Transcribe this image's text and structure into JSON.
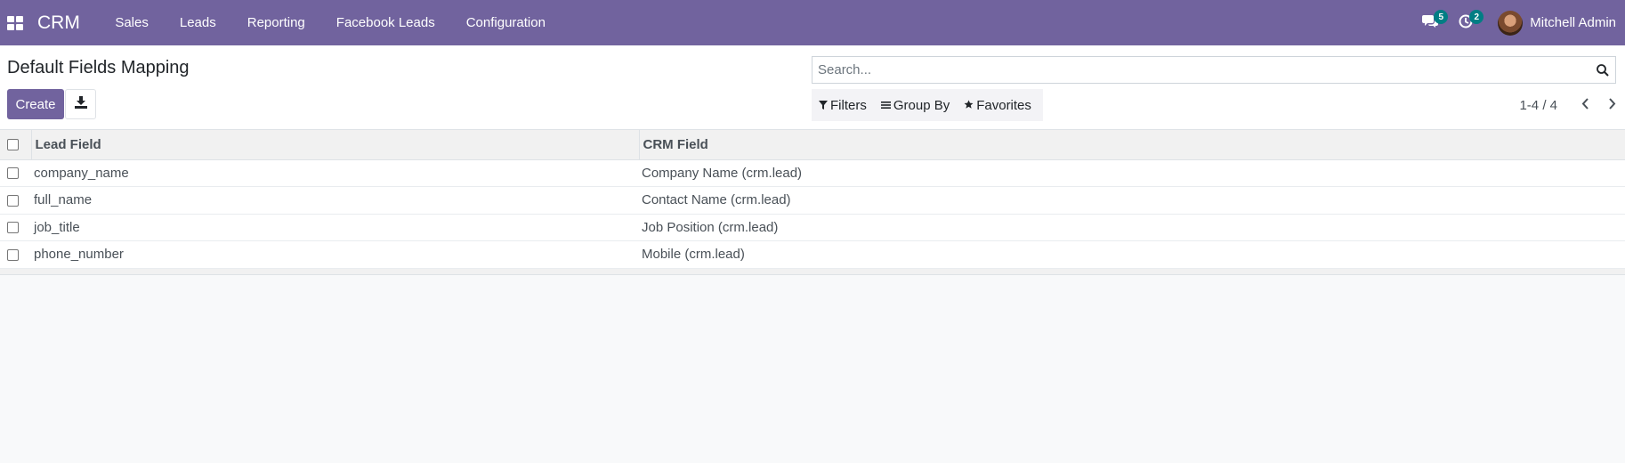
{
  "navbar": {
    "apps_icon": "grid-icon",
    "brand": "CRM",
    "menu": [
      {
        "label": "Sales"
      },
      {
        "label": "Leads"
      },
      {
        "label": "Reporting"
      },
      {
        "label": "Facebook Leads"
      },
      {
        "label": "Configuration"
      }
    ],
    "messages_badge": "5",
    "activities_badge": "2",
    "user_name": "Mitchell Admin",
    "accent": "#71639e",
    "badge_color": "#017e84"
  },
  "control_panel": {
    "title": "Default Fields Mapping",
    "create_label": "Create",
    "search_placeholder": "Search...",
    "filters_label": "Filters",
    "group_by_label": "Group By",
    "favorites_label": "Favorites",
    "pager_value": "1-4 / 4"
  },
  "table": {
    "columns": [
      "Lead Field",
      "CRM Field"
    ],
    "rows": [
      {
        "lead_field": "company_name",
        "crm_field": "Company Name (crm.lead)"
      },
      {
        "lead_field": "full_name",
        "crm_field": "Contact Name (crm.lead)"
      },
      {
        "lead_field": "job_title",
        "crm_field": "Job Position (crm.lead)"
      },
      {
        "lead_field": "phone_number",
        "crm_field": "Mobile (crm.lead)"
      }
    ]
  }
}
